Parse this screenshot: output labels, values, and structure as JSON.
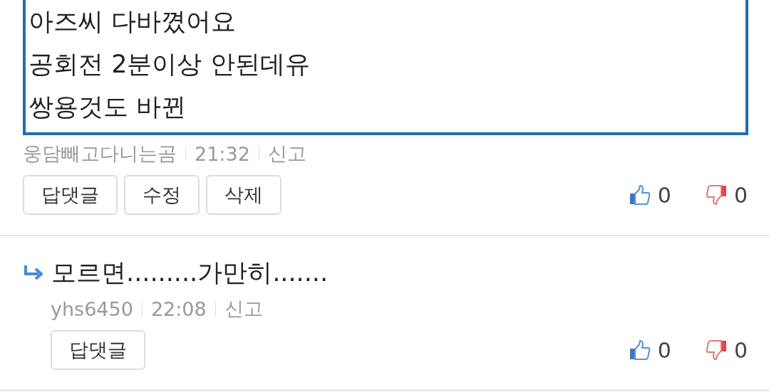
{
  "comments": [
    {
      "kind": "comment",
      "highlighted": true,
      "lines": [
        "아즈씨 다바꼈어요",
        "공회전 2분이상 안된데유",
        "쌍용것도 바뀐"
      ],
      "author": "웅담빼고다니는곰",
      "time": "21:32",
      "report": "신고",
      "buttons": [
        "답댓글",
        "수정",
        "삭제"
      ],
      "likes": "0",
      "dislikes": "0"
    },
    {
      "kind": "reply",
      "highlighted": false,
      "lines": [
        "모르면.........가만히......."
      ],
      "author": "yhs6450",
      "time": "22:08",
      "report": "신고",
      "buttons": [
        "답댓글"
      ],
      "likes": "0",
      "dislikes": "0"
    }
  ]
}
